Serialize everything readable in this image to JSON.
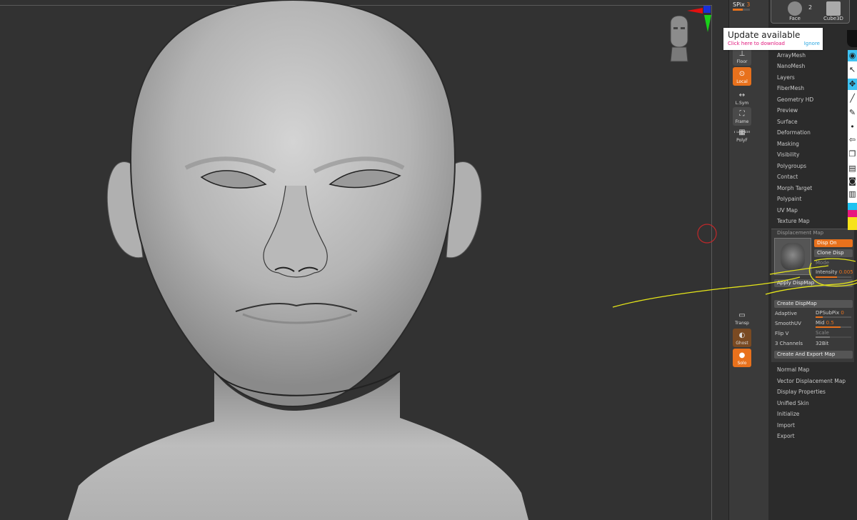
{
  "shelf": {
    "spix_label": "SPix",
    "spix_value": "3",
    "buttons": [
      {
        "key": "floor",
        "label": "Floor"
      },
      {
        "key": "local",
        "label": "Local"
      },
      {
        "key": "lsym",
        "label": "L.Sym"
      },
      {
        "key": "frame",
        "label": "Frame"
      },
      {
        "key": "line_fill",
        "label": "Line Fill"
      },
      {
        "key": "polyf",
        "label": "PolyF"
      },
      {
        "key": "transp",
        "label": "Transp"
      },
      {
        "key": "ghost",
        "label": "Ghost"
      },
      {
        "key": "solo",
        "label": "Solo"
      }
    ]
  },
  "subtool": {
    "items": [
      {
        "name": "Face"
      },
      {
        "name": "Cube3D"
      }
    ],
    "count": "2"
  },
  "update": {
    "title": "Update available",
    "link": "Click here to download",
    "ignore": "Ignore"
  },
  "geometry_menu": [
    "ArrayMesh",
    "NanoMesh",
    "Layers",
    "FiberMesh",
    "Geometry HD",
    "Preview",
    "Surface",
    "Deformation",
    "Masking",
    "Visibility",
    "Polygroups",
    "Contact",
    "Morph Target",
    "Polypaint",
    "UV Map",
    "Texture Map"
  ],
  "displacement": {
    "title": "Displacement Map",
    "disp_on": "Disp On",
    "clone_disp": "Clone Disp",
    "mode": "Mode",
    "intensity_label": "Intensity",
    "intensity_value": "0.005",
    "apply": "Apply DispMap",
    "create": "Create DispMap",
    "adaptive": "Adaptive",
    "dpsubpix_label": "DPSubPix",
    "dpsubpix_value": "0",
    "smoothuv": "SmoothUV",
    "mid_label": "Mid",
    "mid_value": "0.5",
    "flipv": "Flip V",
    "scale": "Scale",
    "channels": "3 Channels",
    "bit": "32Bit",
    "export": "Create And Export Map"
  },
  "lower_menu": [
    "Normal Map",
    "Vector Displacement Map",
    "Display Properties",
    "Unified Skin",
    "Initialize",
    "Import",
    "Export"
  ],
  "icons": [
    "eye-icon",
    "select-arrow-icon",
    "gizmo-icon",
    "brush-icon",
    "pencil-icon",
    "dot-icon",
    "move-arrow-icon",
    "copy-icon",
    "stack-icon",
    "camera-icon",
    "document-icon"
  ],
  "colors": {
    "accent": "#e8711c",
    "annotation": "#e6e619",
    "highlight": "#3ec2f2",
    "link": "#e0157a"
  }
}
